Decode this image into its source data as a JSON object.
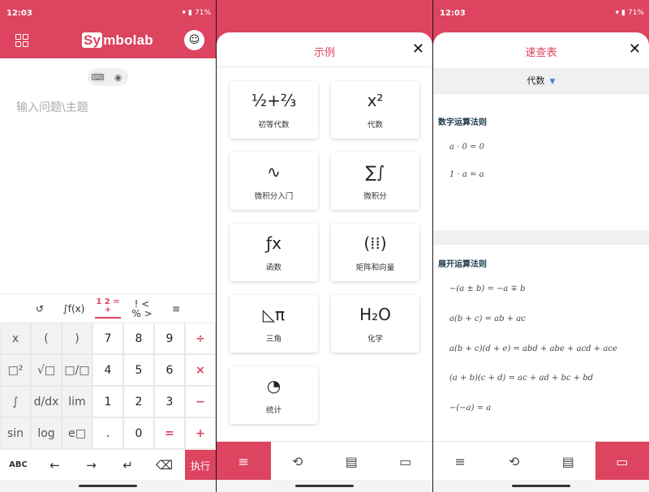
{
  "status": {
    "time": "12:03",
    "battery": "71%"
  },
  "left": {
    "logo_prefix": "Sy",
    "logo_rest": "mbolab",
    "input_placeholder": "输入问题\\主题",
    "kb_tabs": [
      "↺",
      "∫f(x)",
      "1 2 = +",
      "! < %  >",
      "≡"
    ],
    "keys": [
      [
        "x",
        "(",
        ")",
        "7",
        "8",
        "9",
        "÷"
      ],
      [
        "□²",
        "√□",
        "□/□",
        "4",
        "5",
        "6",
        "×"
      ],
      [
        "∫",
        "d/dx",
        "lim",
        "1",
        "2",
        "3",
        "−"
      ],
      [
        "sin",
        "log",
        "e□",
        ".",
        "0",
        "=",
        "+"
      ]
    ],
    "bottom_keys": [
      "ABC",
      "←",
      "→",
      "↵",
      "⌫"
    ],
    "go_label": "执行"
  },
  "examples": {
    "title": "示例",
    "cards": [
      {
        "icon": "½+⅔",
        "label": "初等代数"
      },
      {
        "icon": "x²",
        "label": "代数"
      },
      {
        "icon": "∿",
        "label": "微积分入门"
      },
      {
        "icon": "∑∫",
        "label": "微积分"
      },
      {
        "icon": "ƒx",
        "label": "函数"
      },
      {
        "icon": "(⁞⁞)",
        "label": "矩阵和向量"
      },
      {
        "icon": "◺π",
        "label": "三角"
      },
      {
        "icon": "H₂O",
        "label": "化学"
      },
      {
        "icon": "◔",
        "label": "统计"
      }
    ]
  },
  "cheatsheet": {
    "title": "速查表",
    "category": "代数",
    "section1": "数字运算法则",
    "rules1": [
      "a · 0 = 0",
      "1 · a = a"
    ],
    "section2": "展开运算法则",
    "rules2": [
      "−(a ± b) = −a ∓ b",
      "a(b + c) = ab + ac",
      "a(b + c)(d + e) = abd + abe + acd + ace",
      "(a + b)(c + d) = ac + ad + bc + bd",
      "−(−a) = a"
    ]
  },
  "nav_icons": [
    "≡",
    "⟲",
    "▤",
    "▭"
  ],
  "colors": {
    "accent": "#dc4460"
  }
}
